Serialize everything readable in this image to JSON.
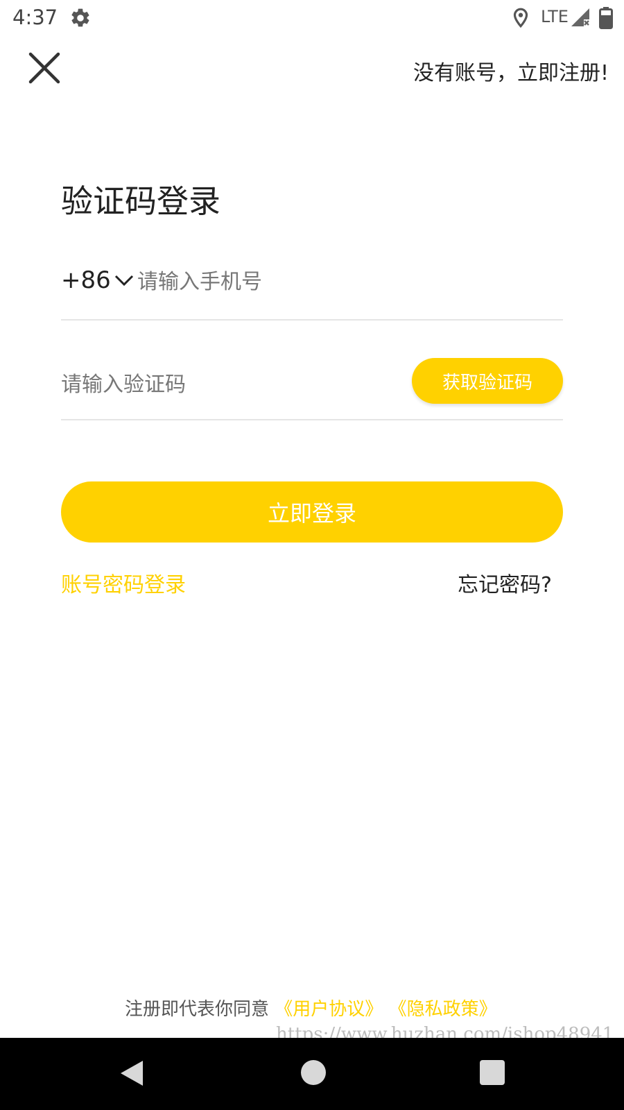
{
  "status_bar": {
    "time": "4:37",
    "network": "LTE",
    "icons": [
      "gear-icon",
      "location-icon",
      "signal-icon",
      "battery-icon"
    ]
  },
  "header": {
    "close_icon": "close-icon",
    "register_link": "没有账号，立即注册!"
  },
  "page_title": "验证码登录",
  "phone": {
    "country_code": "+86",
    "placeholder": "请输入手机号",
    "value": ""
  },
  "code": {
    "placeholder": "请输入验证码",
    "value": "",
    "get_code_label": "获取验证码"
  },
  "login_button": "立即登录",
  "password_login_link": "账号密码登录",
  "forgot_link": "忘记密码?",
  "agreement": {
    "prefix": "注册即代表你同意",
    "user_agreement": "《用户协议》",
    "privacy_policy": "《隐私政策》"
  },
  "watermark": "https://www.huzhan.com/ishop48941",
  "colors": {
    "accent": "#ffd100",
    "text": "#222222",
    "placeholder": "#777777",
    "divider": "#e5e5e5"
  },
  "nav_bar": {
    "icons": [
      "back-icon",
      "home-icon",
      "recent-apps-icon"
    ]
  }
}
